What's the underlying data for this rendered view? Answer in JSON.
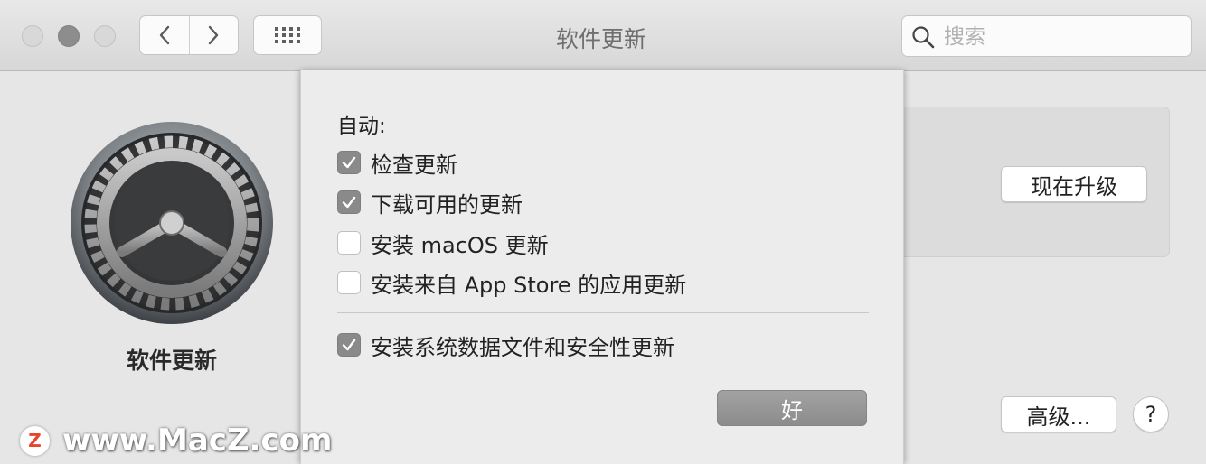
{
  "window": {
    "title": "软件更新"
  },
  "search": {
    "placeholder": "搜索",
    "value": ""
  },
  "pane": {
    "title": "软件更新"
  },
  "buttons": {
    "upgrade": "现在升级",
    "advanced": "高级...",
    "help": "?"
  },
  "sheet": {
    "label": "自动:",
    "options": [
      {
        "label": "检查更新",
        "checked": true
      },
      {
        "label": "下载可用的更新",
        "checked": true
      },
      {
        "label": "安装 macOS 更新",
        "checked": false
      },
      {
        "label": "安装来自 App Store 的应用更新",
        "checked": false
      },
      {
        "label": "安装系统数据文件和安全性更新",
        "checked": true
      }
    ],
    "ok": "好"
  },
  "watermark": {
    "logo": "Z",
    "text": "www.MacZ.com"
  },
  "icons": [
    "back-chevron-icon",
    "forward-chevron-icon",
    "grid-icon",
    "search-icon",
    "gear-icon",
    "checkmark-icon"
  ],
  "colors": {
    "checkbox_checked": "#8a8a8a",
    "ok_button": "#969696",
    "titlebar": "#dfdfdf"
  }
}
